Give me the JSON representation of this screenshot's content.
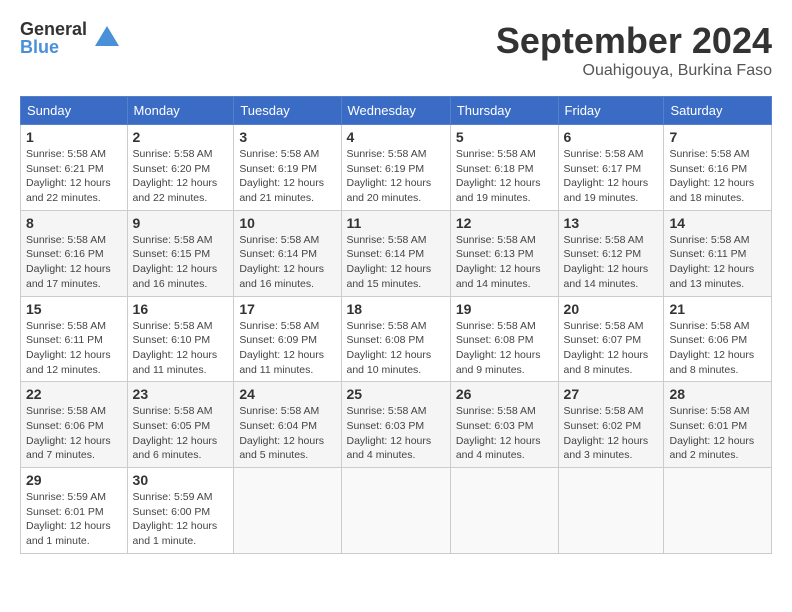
{
  "header": {
    "logo_general": "General",
    "logo_blue": "Blue",
    "month_title": "September 2024",
    "location": "Ouahigouya, Burkina Faso"
  },
  "weekdays": [
    "Sunday",
    "Monday",
    "Tuesday",
    "Wednesday",
    "Thursday",
    "Friday",
    "Saturday"
  ],
  "weeks": [
    [
      {
        "day": "1",
        "sunrise": "5:58 AM",
        "sunset": "6:21 PM",
        "daylight": "12 hours and 22 minutes."
      },
      {
        "day": "2",
        "sunrise": "5:58 AM",
        "sunset": "6:20 PM",
        "daylight": "12 hours and 22 minutes."
      },
      {
        "day": "3",
        "sunrise": "5:58 AM",
        "sunset": "6:19 PM",
        "daylight": "12 hours and 21 minutes."
      },
      {
        "day": "4",
        "sunrise": "5:58 AM",
        "sunset": "6:19 PM",
        "daylight": "12 hours and 20 minutes."
      },
      {
        "day": "5",
        "sunrise": "5:58 AM",
        "sunset": "6:18 PM",
        "daylight": "12 hours and 19 minutes."
      },
      {
        "day": "6",
        "sunrise": "5:58 AM",
        "sunset": "6:17 PM",
        "daylight": "12 hours and 19 minutes."
      },
      {
        "day": "7",
        "sunrise": "5:58 AM",
        "sunset": "6:16 PM",
        "daylight": "12 hours and 18 minutes."
      }
    ],
    [
      {
        "day": "8",
        "sunrise": "5:58 AM",
        "sunset": "6:16 PM",
        "daylight": "12 hours and 17 minutes."
      },
      {
        "day": "9",
        "sunrise": "5:58 AM",
        "sunset": "6:15 PM",
        "daylight": "12 hours and 16 minutes."
      },
      {
        "day": "10",
        "sunrise": "5:58 AM",
        "sunset": "6:14 PM",
        "daylight": "12 hours and 16 minutes."
      },
      {
        "day": "11",
        "sunrise": "5:58 AM",
        "sunset": "6:14 PM",
        "daylight": "12 hours and 15 minutes."
      },
      {
        "day": "12",
        "sunrise": "5:58 AM",
        "sunset": "6:13 PM",
        "daylight": "12 hours and 14 minutes."
      },
      {
        "day": "13",
        "sunrise": "5:58 AM",
        "sunset": "6:12 PM",
        "daylight": "12 hours and 14 minutes."
      },
      {
        "day": "14",
        "sunrise": "5:58 AM",
        "sunset": "6:11 PM",
        "daylight": "12 hours and 13 minutes."
      }
    ],
    [
      {
        "day": "15",
        "sunrise": "5:58 AM",
        "sunset": "6:11 PM",
        "daylight": "12 hours and 12 minutes."
      },
      {
        "day": "16",
        "sunrise": "5:58 AM",
        "sunset": "6:10 PM",
        "daylight": "12 hours and 11 minutes."
      },
      {
        "day": "17",
        "sunrise": "5:58 AM",
        "sunset": "6:09 PM",
        "daylight": "12 hours and 11 minutes."
      },
      {
        "day": "18",
        "sunrise": "5:58 AM",
        "sunset": "6:08 PM",
        "daylight": "12 hours and 10 minutes."
      },
      {
        "day": "19",
        "sunrise": "5:58 AM",
        "sunset": "6:08 PM",
        "daylight": "12 hours and 9 minutes."
      },
      {
        "day": "20",
        "sunrise": "5:58 AM",
        "sunset": "6:07 PM",
        "daylight": "12 hours and 8 minutes."
      },
      {
        "day": "21",
        "sunrise": "5:58 AM",
        "sunset": "6:06 PM",
        "daylight": "12 hours and 8 minutes."
      }
    ],
    [
      {
        "day": "22",
        "sunrise": "5:58 AM",
        "sunset": "6:06 PM",
        "daylight": "12 hours and 7 minutes."
      },
      {
        "day": "23",
        "sunrise": "5:58 AM",
        "sunset": "6:05 PM",
        "daylight": "12 hours and 6 minutes."
      },
      {
        "day": "24",
        "sunrise": "5:58 AM",
        "sunset": "6:04 PM",
        "daylight": "12 hours and 5 minutes."
      },
      {
        "day": "25",
        "sunrise": "5:58 AM",
        "sunset": "6:03 PM",
        "daylight": "12 hours and 4 minutes."
      },
      {
        "day": "26",
        "sunrise": "5:58 AM",
        "sunset": "6:03 PM",
        "daylight": "12 hours and 4 minutes."
      },
      {
        "day": "27",
        "sunrise": "5:58 AM",
        "sunset": "6:02 PM",
        "daylight": "12 hours and 3 minutes."
      },
      {
        "day": "28",
        "sunrise": "5:58 AM",
        "sunset": "6:01 PM",
        "daylight": "12 hours and 2 minutes."
      }
    ],
    [
      {
        "day": "29",
        "sunrise": "5:59 AM",
        "sunset": "6:01 PM",
        "daylight": "12 hours and 1 minute."
      },
      {
        "day": "30",
        "sunrise": "5:59 AM",
        "sunset": "6:00 PM",
        "daylight": "12 hours and 1 minute."
      },
      null,
      null,
      null,
      null,
      null
    ]
  ]
}
